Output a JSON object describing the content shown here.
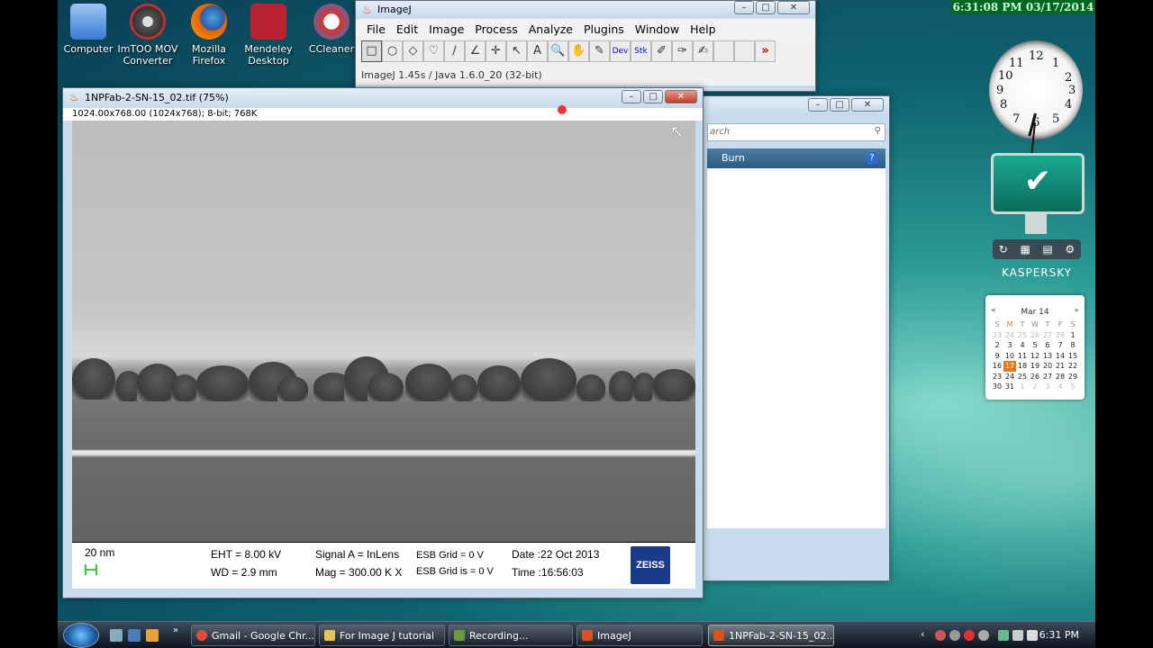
{
  "clock_bar": "6:31:08 PM 03/17/2014",
  "desktop_icons": [
    {
      "label": "Computer",
      "color": "#3a7bd5"
    },
    {
      "label": "ImTOO MOV Converter",
      "color": "#555555"
    },
    {
      "label": "Mozilla Firefox",
      "color": "#e66000"
    },
    {
      "label": "Mendeley Desktop",
      "color": "#b8232f"
    },
    {
      "label": "CCleaner",
      "color": "#d33"
    }
  ],
  "imagej": {
    "title": "ImageJ",
    "menu": [
      "File",
      "Edit",
      "Image",
      "Process",
      "Analyze",
      "Plugins",
      "Window",
      "Help"
    ],
    "tools": [
      "□",
      "○",
      "◇",
      "♡",
      "∕",
      "∠",
      "✛",
      "↖",
      "A",
      "🔍",
      "✋",
      "✎",
      "Dev",
      "Stk",
      "✐",
      "✑",
      "✍",
      "",
      "",
      "»"
    ],
    "status": "ImageJ 1.45s / Java 1.6.0_20 (32-bit)"
  },
  "image_window": {
    "title": "1NPFab-2-SN-15_02.tif (75%)",
    "info": "1024.00x768.00  (1024x768); 8-bit; 768K",
    "databar": {
      "scale": "20 nm",
      "eht": "EHT =  8.00 kV",
      "wd": "WD =  2.9 mm",
      "signal": "Signal A = InLens",
      "mag": "Mag =  300.00 K X",
      "esb_grid": "ESB Grid =     0 V",
      "esb_grid_is": "ESB Grid is =    0 V",
      "date": "Date :22 Oct 2013",
      "time": "Time :16:56:03",
      "logo": "ZEISS"
    }
  },
  "bg_window": {
    "search": "arch",
    "burn_label": "Burn",
    "help": "?"
  },
  "clock_gadget": {
    "numbers": [
      "12",
      "1",
      "2",
      "3",
      "4",
      "5",
      "6",
      "7",
      "8",
      "9",
      "10",
      "11"
    ]
  },
  "kaspersky": {
    "label": "KASPERSKY"
  },
  "calendar": {
    "month": "Mar 14",
    "weekdays": [
      "S",
      "M",
      "T",
      "W",
      "T",
      "F",
      "S"
    ],
    "days": [
      [
        "23",
        "24",
        "25",
        "26",
        "27",
        "28",
        "1"
      ],
      [
        "2",
        "3",
        "4",
        "5",
        "6",
        "7",
        "8"
      ],
      [
        "9",
        "10",
        "11",
        "12",
        "13",
        "14",
        "15"
      ],
      [
        "16",
        "17",
        "18",
        "19",
        "20",
        "21",
        "22"
      ],
      [
        "23",
        "24",
        "25",
        "26",
        "27",
        "28",
        "29"
      ],
      [
        "30",
        "31",
        "1",
        "2",
        "3",
        "4",
        "5"
      ]
    ],
    "today": "17"
  },
  "taskbar": {
    "buttons": [
      {
        "label": "Gmail - Google Chr...",
        "color": "#dd4b39"
      },
      {
        "label": "For Image J tutorial",
        "color": "#e8c35a"
      },
      {
        "label": "Recording...",
        "color": "#6a9a3a"
      },
      {
        "label": "ImageJ",
        "color": "#d9531e"
      },
      {
        "label": "1NPFab-2-SN-15_02...",
        "color": "#d9531e"
      }
    ],
    "time": "6:31 PM"
  }
}
